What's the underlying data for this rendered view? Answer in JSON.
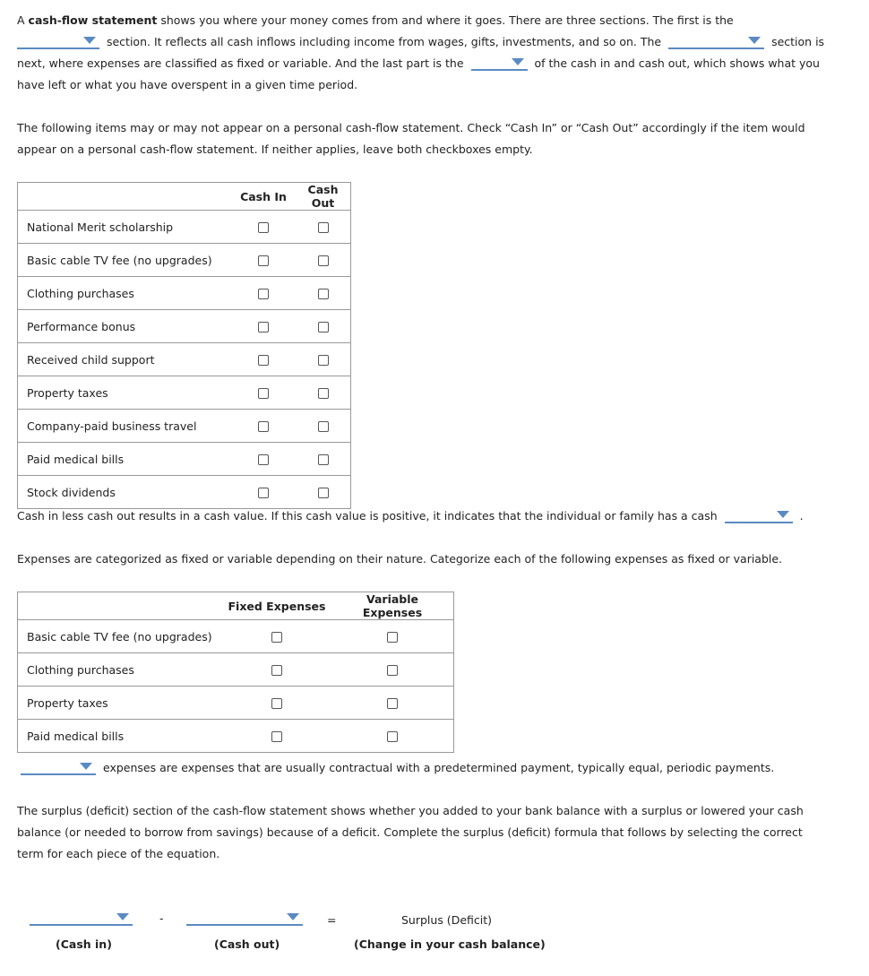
{
  "intro": {
    "p1_a": "A ",
    "p1_bold": "cash-flow statement",
    "p1_b": " shows you where your money comes from and where it goes. There are three sections. The first is the",
    "p1_c": "section. It reflects all cash inflows including income from wages, gifts, investments, and so on. The",
    "p1_d": "section is next, where expenses are classified as fixed or variable. And the last part is the",
    "p1_e": "of the cash in and cash out, which shows what you have left or what you have overspent in a given time period.",
    "dropdown1_value": "",
    "dropdown2_value": "",
    "dropdown3_value": ""
  },
  "instructions1": "The following items may or may not appear on a personal cash-flow statement. Check “Cash In” or “Cash Out” accordingly if the item would appear on a personal cash-flow statement. If neither applies, leave both checkboxes empty.",
  "table1": {
    "headers": [
      "",
      "Cash In",
      "Cash Out"
    ],
    "rows": [
      {
        "label": "National Merit scholarship",
        "cash_in": false,
        "cash_out": false
      },
      {
        "label": "Basic cable TV fee (no upgrades)",
        "cash_in": false,
        "cash_out": false
      },
      {
        "label": "Clothing purchases",
        "cash_in": false,
        "cash_out": false
      },
      {
        "label": "Performance bonus",
        "cash_in": false,
        "cash_out": false
      },
      {
        "label": "Received child support",
        "cash_in": false,
        "cash_out": false
      },
      {
        "label": "Property taxes",
        "cash_in": false,
        "cash_out": false
      },
      {
        "label": "Company-paid business travel",
        "cash_in": false,
        "cash_out": false
      },
      {
        "label": "Paid medical bills",
        "cash_in": false,
        "cash_out": false
      },
      {
        "label": "Stock dividends",
        "cash_in": false,
        "cash_out": false
      }
    ]
  },
  "cash_value": {
    "text": "Cash in less cash out results in a cash value. If this cash value is positive, it indicates that the individual or family has a cash",
    "dropdown_value": "",
    "end": "."
  },
  "instructions2": "Expenses are categorized as fixed or variable depending on their nature. Categorize each of the following expenses as fixed or variable.",
  "table2": {
    "headers": [
      "",
      "Fixed Expenses",
      "Variable Expenses"
    ],
    "rows": [
      {
        "label": "Basic cable TV fee (no upgrades)",
        "fixed": false,
        "variable": false
      },
      {
        "label": "Clothing purchases",
        "fixed": false,
        "variable": false
      },
      {
        "label": "Property taxes",
        "fixed": false,
        "variable": false
      },
      {
        "label": "Paid medical bills",
        "fixed": false,
        "variable": false
      }
    ]
  },
  "fixed_sentence": {
    "dropdown_value": "",
    "text": "expenses are expenses that are usually contractual with a predetermined payment, typically equal, periodic payments."
  },
  "surplus_para": "The surplus (deficit) section of the cash-flow statement shows whether you added to your bank balance with a surplus or lowered your cash balance (or needed to borrow from savings) because of a deficit. Complete the surplus (deficit) formula that follows by selecting the correct term for each piece of the equation.",
  "formula": {
    "term1_value": "",
    "minus": "-",
    "term2_value": "",
    "equals": "=",
    "result": "Surplus (Deficit)",
    "label1": "(Cash in)",
    "label2": "(Cash out)",
    "label3": "(Change in your cash balance)"
  },
  "colors": {
    "accent": "#5b8ac2",
    "border": "#999999"
  }
}
